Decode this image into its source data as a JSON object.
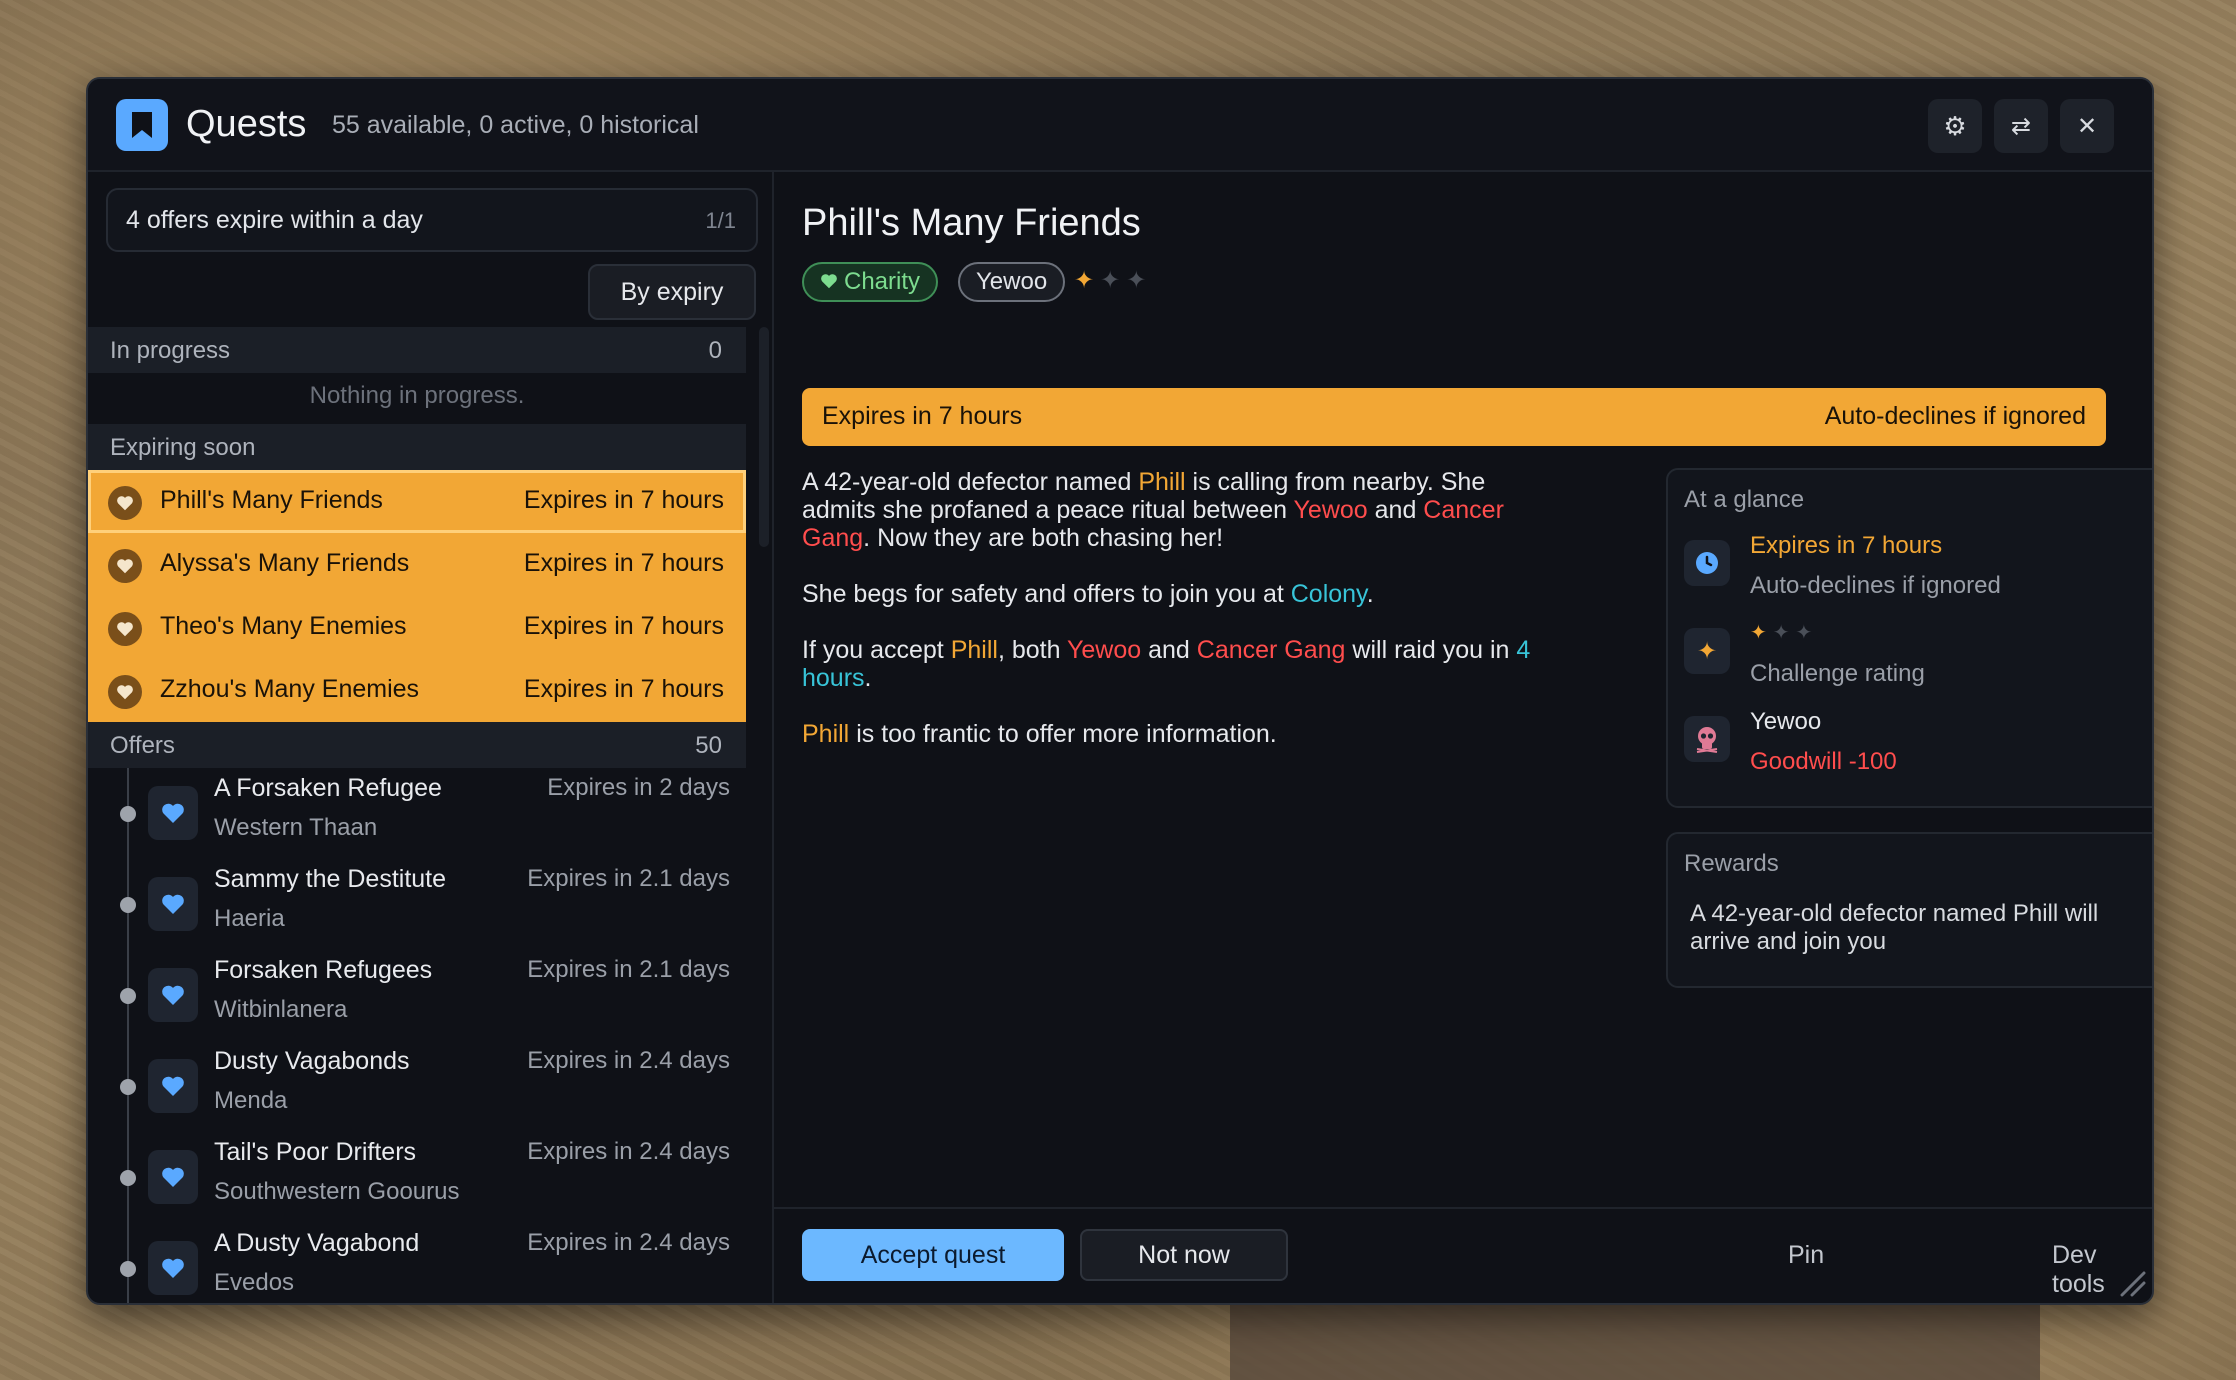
{
  "window": {
    "title": "Quests",
    "subtitle": "55 available, 0 active, 0 historical",
    "icons": {
      "app": "bookmark-icon",
      "settings": "gear-icon",
      "swap": "swap-icon",
      "close": "close-icon"
    }
  },
  "filter": {
    "text": "4 offers expire within a day",
    "count": "1/1"
  },
  "sort_label": "By expiry",
  "sections": {
    "in_progress": {
      "label": "In progress",
      "count": "0",
      "empty": "Nothing in progress."
    },
    "expiring": {
      "label": "Expiring soon"
    },
    "offers": {
      "label": "Offers",
      "count": "50"
    }
  },
  "expiring_items": [
    {
      "name": "Phill's Many Friends",
      "time": "Expires in 7 hours",
      "selected": true
    },
    {
      "name": "Alyssa's Many Friends",
      "time": "Expires in 7 hours"
    },
    {
      "name": "Theo's Many Enemies",
      "time": "Expires in 7 hours"
    },
    {
      "name": "Zzhou's Many Enemies",
      "time": "Expires in 7 hours"
    }
  ],
  "offers": [
    {
      "name": "A Forsaken Refugee",
      "location": "Western Thaan",
      "time": "Expires in 2 days"
    },
    {
      "name": "Sammy the Destitute",
      "location": "Haeria",
      "time": "Expires in 2.1 days"
    },
    {
      "name": "Forsaken Refugees",
      "location": "Witbinlanera",
      "time": "Expires in 2.1 days"
    },
    {
      "name": "Dusty Vagabonds",
      "location": "Menda",
      "time": "Expires in 2.4 days"
    },
    {
      "name": "Tail's Poor Drifters",
      "location": "Southwestern Goourus",
      "time": "Expires in 2.4 days"
    },
    {
      "name": "A Dusty Vagabond",
      "location": "Evedos",
      "time": "Expires in 2.4 days"
    }
  ],
  "detail": {
    "title": "Phill's Many Friends",
    "tags": {
      "charity": "Charity",
      "faction": "Yewoo"
    },
    "challenge_stars": {
      "filled": 1,
      "total": 3
    },
    "banner": {
      "left": "Expires in 7 hours",
      "right": "Auto-declines if ignored"
    },
    "desc": {
      "p1": {
        "a": "A 42-year-old defector named ",
        "b": "Phill",
        "c": " is calling from nearby. She admits she profaned a peace ritual between ",
        "d": "Yewoo",
        "e": " and ",
        "f": "Cancer Gang",
        "g": ". Now they are both chasing her!"
      },
      "p2": {
        "a": "She begs for safety and offers to join you at ",
        "b": "Colony",
        "c": "."
      },
      "p3": {
        "a": "If you accept ",
        "b": "Phill",
        "c": ", both ",
        "d": "Yewoo",
        "e": " and ",
        "f": "Cancer Gang",
        "g": " will raid you in ",
        "h": "4 hours",
        "i": "."
      },
      "p4": {
        "a": "Phill",
        "b": " is too frantic to offer more information."
      }
    },
    "glance": {
      "header": "At a glance",
      "expires": "Expires in 7 hours",
      "autodecline": "Auto-declines if ignored",
      "challenge_label": "Challenge rating",
      "faction": "Yewoo",
      "goodwill": "Goodwill -100"
    },
    "rewards": {
      "header": "Rewards",
      "text": "A 42-year-old defector named Phill will arrive and join you"
    }
  },
  "footer": {
    "accept": "Accept quest",
    "not_now": "Not now",
    "pin": "Pin",
    "dev_tools": "Dev tools"
  },
  "colors": {
    "accent_orange": "#f2a735",
    "accent_blue": "#6cb8ff",
    "hostile_red": "#ff4d4d",
    "charity_green": "#7ddc8f",
    "link_cyan": "#38c4d8"
  }
}
